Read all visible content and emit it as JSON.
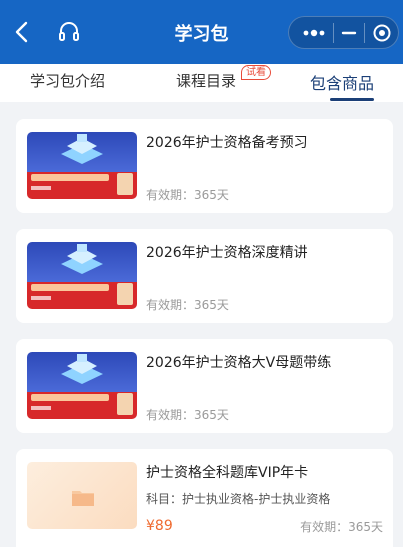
{
  "header": {
    "title": "学习包",
    "back_icon": "chevron-left-icon",
    "service_icon": "headset-icon",
    "capsule": {
      "more_icon": "more-dots-icon",
      "minimize_icon": "minus-icon",
      "close_icon": "target-circle-icon"
    }
  },
  "tabs": [
    {
      "label": "学习包介绍",
      "active": false
    },
    {
      "label": "课程目录",
      "active": false,
      "badge": "试看"
    },
    {
      "label": "包含商品",
      "active": true
    }
  ],
  "products": [
    {
      "title": "2026年护士资格备考预习",
      "validity": "有效期：365天"
    },
    {
      "title": "2026年护士资格深度精讲",
      "validity": "有效期：365天"
    },
    {
      "title": "2026年护士资格大V母题带练",
      "validity": "有效期：365天"
    },
    {
      "title": "护士资格全科题库VIP年卡",
      "subject": "科目：护士执业资格-护士执业资格",
      "price": "¥89",
      "validity": "有效期：365天"
    }
  ],
  "colors": {
    "header": "#1666c4",
    "active_tab": "#1b3f77",
    "price": "#ef6a2f",
    "badge": "#e84b3a"
  }
}
